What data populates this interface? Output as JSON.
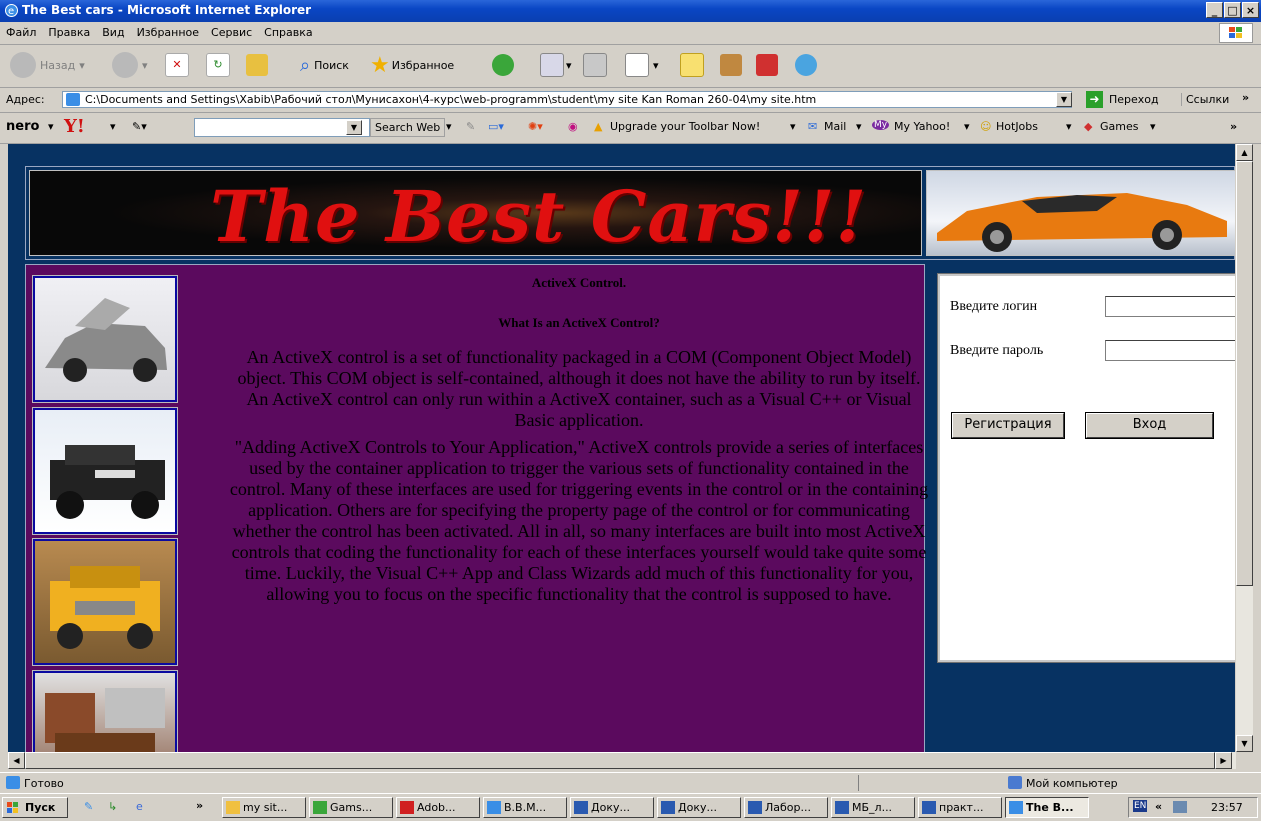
{
  "window": {
    "title": "The Best cars - Microsoft Internet Explorer",
    "minimize": "_",
    "maximize": "□",
    "close": "×"
  },
  "menu": {
    "items": [
      "Файл",
      "Правка",
      "Вид",
      "Избранное",
      "Сервис",
      "Справка"
    ]
  },
  "toolbar": {
    "back_label": "Назад",
    "search_label": "Поиск",
    "favorites_label": "Избранное"
  },
  "address": {
    "label": "Адрес:",
    "url": "C:\\Documents and Settings\\Xabib\\Рабочий стол\\Мунисахон\\4-курс\\web-programm\\student\\my site Kan Roman 260-04\\my site.htm",
    "go_label": "Переход",
    "links_label": "Ссылки",
    "more": "»"
  },
  "nero_bar": {
    "nero": "nero",
    "yahoo": "Y!",
    "search_web": "Search Web",
    "upgrade": "Upgrade your Toolbar Now!",
    "mail": "Mail",
    "my_yahoo": "My Yahoo!",
    "hotjobs": "HotJobs",
    "games": "Games",
    "more": "»"
  },
  "page": {
    "banner_title": "The Best Cars!!!",
    "article": {
      "heading": "ActiveX Control.",
      "subheading": "What Is an ActiveX Control?",
      "para1": "An ActiveX control is a set of functionality packaged in a COM (Component Object Model) object. This COM object is self-contained, although it does not have the ability to run by itself. An ActiveX control can only run within a ActiveX container, such as a Visual C++ or Visual Basic application.",
      "para2": "\"Adding ActiveX Controls to Your Application,\" ActiveX controls provide a series of interfaces used by the container application to trigger the various sets of functionality contained in the control. Many of these interfaces are used for triggering events in the control or in the containing application. Others are for specifying the property page of the control or for communicating whether the control has been activated. All in all, so many interfaces are built into most ActiveX controls that coding the functionality for each of these interfaces yourself would take quite some time. Luckily, the Visual C++ App and Class Wizards add much of this functionality for you, allowing you to focus on the specific functionality that the control is supposed to have."
    },
    "login": {
      "login_label": "Введите логин",
      "password_label": "Введите пароль",
      "login_value": "",
      "password_value": "",
      "register_button": "Регистрация",
      "enter_button": "Вход"
    }
  },
  "status": {
    "text": "Готово",
    "zone": "Мой компьютер"
  },
  "taskbar": {
    "start": "Пуск",
    "more": "»",
    "tasks": [
      "my sit...",
      "Gams...",
      "Adob...",
      "В.В.М...",
      "Доку...",
      "Доку...",
      "Лабор...",
      "МБ_л...",
      "практ...",
      "The B..."
    ],
    "lang": "EN",
    "tray_more": "«",
    "clock": "23:57"
  },
  "colors": {
    "page_bg": "#073262",
    "content_bg": "#5b0a5e",
    "banner_text": "#e01010",
    "titlebar": "#0a46c4"
  }
}
